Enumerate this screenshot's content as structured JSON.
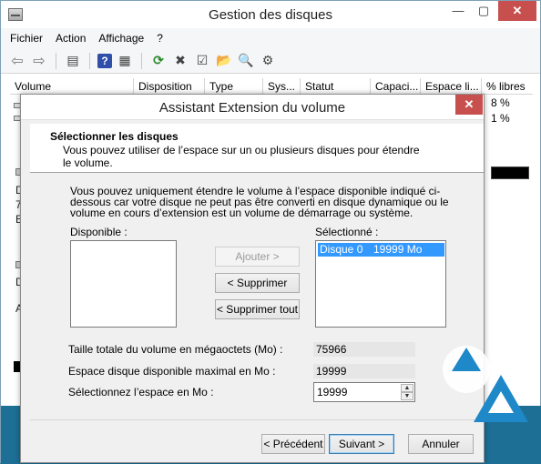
{
  "window": {
    "title": "Gestion des disques",
    "min": "—",
    "max": "▢",
    "close": "✕"
  },
  "menu": [
    "Fichier",
    "Action",
    "Affichage",
    "?"
  ],
  "columns": [
    "Volume",
    "Disposition",
    "Type",
    "Sys...",
    "Statut",
    "Capaci...",
    "Espace li...",
    "% libres"
  ],
  "pct_values": [
    "8 %",
    "1 %"
  ],
  "left_fragments": [
    "D",
    "7",
    "E",
    "D",
    "A"
  ],
  "dialog": {
    "title": "Assistant Extension du volume",
    "close": "✕",
    "header_title": "Sélectionner les disques",
    "header_subtitle": "Vous pouvez utiliser de l’espace sur un ou plusieurs disques pour étendre le volume.",
    "intro": "Vous pouvez uniquement étendre le volume à l’espace disponible indiqué ci-dessous car votre disque ne peut pas être converti en disque dynamique ou le volume en cours d’extension est un volume de démarrage ou système.",
    "available_label": "Disponible :",
    "selected_label": "Sélectionné :",
    "selected_items": [
      {
        "name": "Disque 0",
        "size": "19999 Mo"
      }
    ],
    "add_button": "Ajouter >",
    "remove_button": "< Supprimer",
    "remove_all_button": "< Supprimer tout",
    "total_size_label": "Taille totale du volume en mégaoctets (Mo) :",
    "total_size_value": "75966",
    "max_space_label": "Espace disque disponible maximal en Mo :",
    "max_space_value": "19999",
    "select_space_label": "Sélectionnez l’espace en Mo :",
    "select_space_value": "19999",
    "prev_button": "< Précédent",
    "next_button": "Suivant >",
    "cancel_button": "Annuler"
  },
  "colors": {
    "accent_close": "#c7504e",
    "selection": "#3399ff",
    "watermark_blue": "#1e88c8"
  }
}
